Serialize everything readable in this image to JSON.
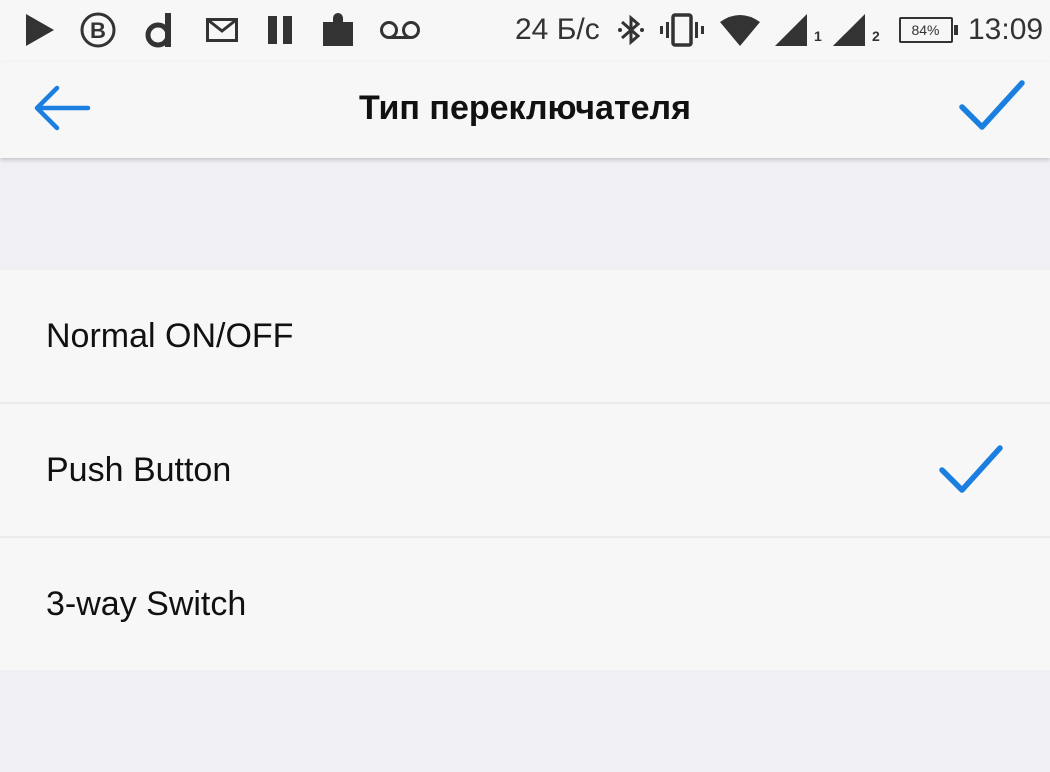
{
  "status_bar": {
    "net_speed": "24 Б/с",
    "battery": "84%",
    "time": "13:09",
    "sim1": "1",
    "sim2": "2",
    "icons": [
      "play-icon",
      "bitcoin-icon",
      "d-app-icon",
      "mail-icon",
      "pause-icon",
      "extension-icon",
      "voicemail-icon",
      "bluetooth-icon",
      "vibrate-icon",
      "wifi-icon",
      "signal-icon",
      "signal-icon",
      "battery-icon"
    ]
  },
  "header": {
    "title": "Тип переключателя",
    "back_icon": "arrow-left-icon",
    "done_icon": "checkmark-icon"
  },
  "options": [
    {
      "label": "Normal ON/OFF",
      "selected": false
    },
    {
      "label": "Push Button",
      "selected": true
    },
    {
      "label": "3-way Switch",
      "selected": false
    }
  ],
  "colors": {
    "accent": "#1a7fe0",
    "background": "#efeff4",
    "surface": "#f7f7f7"
  }
}
